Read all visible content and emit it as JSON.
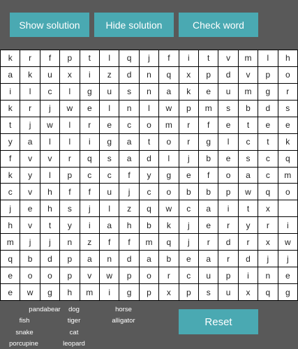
{
  "toolbar": {
    "show_label": "Show solution",
    "hide_label": "Hide solution",
    "check_label": "Check word"
  },
  "reset_label": "Reset",
  "colors": {
    "background": "#595959",
    "button": "#4aa9b2",
    "cell": "#ffffff"
  },
  "grid": [
    [
      "k",
      "r",
      "f",
      "p",
      "t",
      "l",
      "q",
      "j",
      "f",
      "i",
      "t",
      "v",
      "m",
      "l",
      "h"
    ],
    [
      "a",
      "k",
      "u",
      "x",
      "i",
      "z",
      "d",
      "n",
      "q",
      "x",
      "p",
      "d",
      "v",
      "p",
      "o"
    ],
    [
      "i",
      "l",
      "c",
      "l",
      "g",
      "u",
      "s",
      "n",
      "a",
      "k",
      "e",
      "u",
      "m",
      "g",
      "r"
    ],
    [
      "k",
      "r",
      "j",
      "w",
      "e",
      "l",
      "n",
      "l",
      "w",
      "p",
      "m",
      "s",
      "b",
      "d",
      "s"
    ],
    [
      "t",
      "j",
      "w",
      "l",
      "r",
      "e",
      "c",
      "o",
      "m",
      "r",
      "f",
      "e",
      "t",
      "e",
      "e"
    ],
    [
      "y",
      "a",
      "l",
      "l",
      "i",
      "g",
      "a",
      "t",
      "o",
      "r",
      "g",
      "l",
      "c",
      "t",
      "k"
    ],
    [
      "f",
      "v",
      "v",
      "r",
      "q",
      "s",
      "a",
      "d",
      "l",
      "j",
      "b",
      "e",
      "s",
      "c",
      "q"
    ],
    [
      "k",
      "y",
      "l",
      "p",
      "c",
      "c",
      "f",
      "y",
      "g",
      "e",
      "f",
      "o",
      "a",
      "c",
      "m"
    ],
    [
      "c",
      "v",
      "h",
      "f",
      "f",
      "u",
      "j",
      "c",
      "o",
      "b",
      "b",
      "p",
      "w",
      "q",
      "o"
    ],
    [
      "j",
      "e",
      "h",
      "s",
      "j",
      "l",
      "z",
      "q",
      "w",
      "c",
      "a",
      "i",
      "t",
      "x",
      " "
    ],
    [
      "h",
      "v",
      "t",
      "y",
      "i",
      "a",
      "h",
      "b",
      "k",
      "j",
      "e",
      "r",
      "y",
      "r",
      "i"
    ],
    [
      "m",
      "j",
      "j",
      "n",
      "z",
      "f",
      "f",
      "m",
      "q",
      "j",
      "r",
      "d",
      "r",
      "x",
      "w"
    ],
    [
      "q",
      "b",
      "d",
      "p",
      "a",
      "n",
      "d",
      "a",
      "b",
      "e",
      "a",
      "r",
      "d",
      "j",
      "j"
    ],
    [
      "e",
      "o",
      "o",
      "p",
      "v",
      "w",
      "p",
      "o",
      "r",
      "c",
      "u",
      "p",
      "i",
      "n",
      "e"
    ],
    [
      "e",
      "w",
      "g",
      "h",
      "m",
      "i",
      "g",
      "p",
      "x",
      "p",
      "s",
      "u",
      "x",
      "q",
      "g"
    ]
  ],
  "word_list": [
    "pandabear",
    "dog",
    "horse",
    "fish",
    "tiger",
    "alligator",
    "snake",
    "cat",
    "porcupine",
    "leopard"
  ]
}
